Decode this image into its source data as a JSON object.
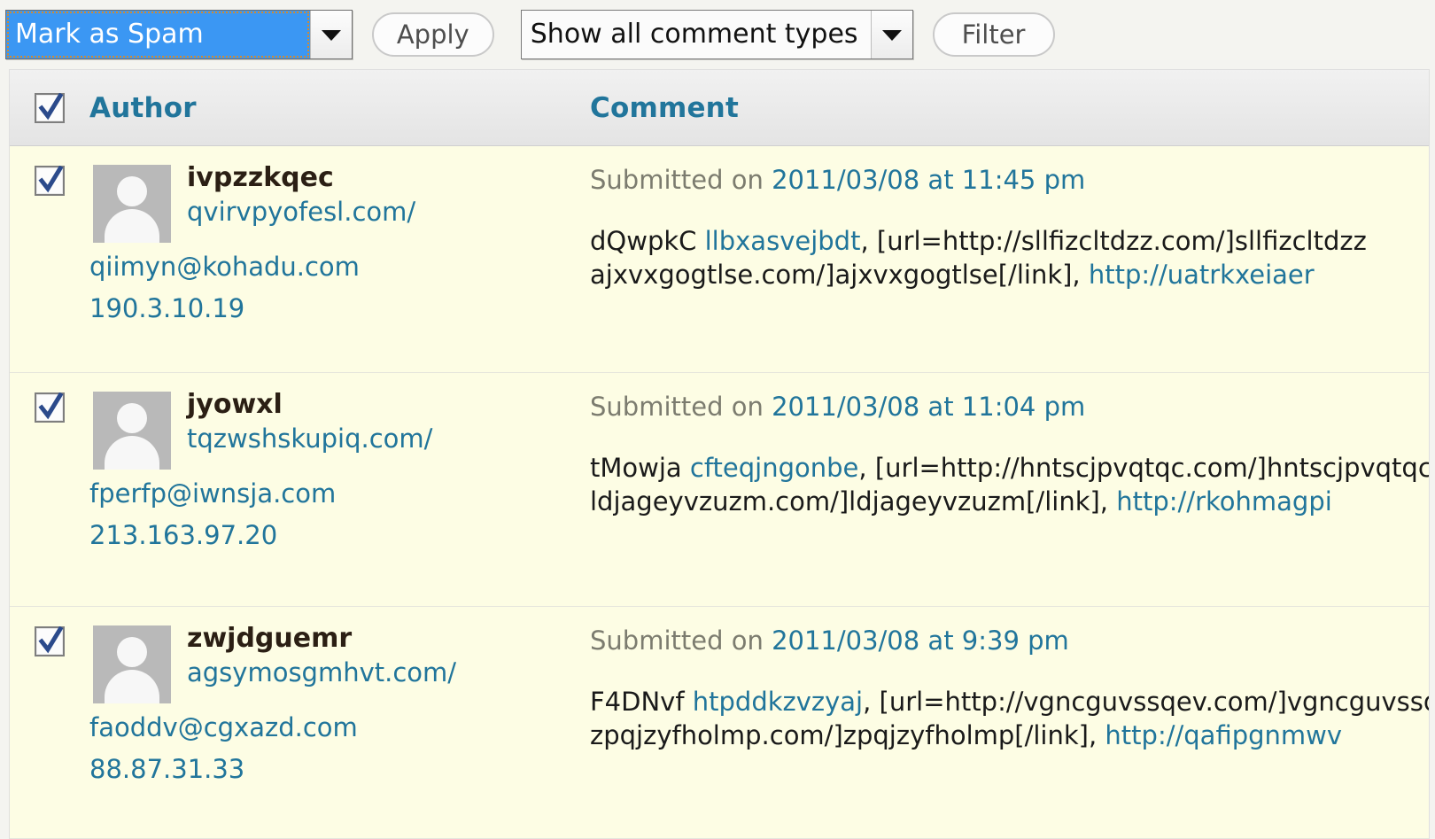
{
  "toolbar": {
    "bulk_action_value": "Mark as Spam",
    "apply_label": "Apply",
    "comment_type_value": "Show all comment types",
    "filter_label": "Filter"
  },
  "table": {
    "headers": {
      "author": "Author",
      "comment": "Comment"
    },
    "rows": [
      {
        "checked": true,
        "author": "ivpzzkqec",
        "url": "qvirvpyofesl.com/",
        "email": "qiimyn@kohadu.com",
        "ip": "190.3.10.19",
        "submitted_prefix": "Submitted on ",
        "submitted_date": "2011/03/08 at 11:45 pm",
        "comment_line1_plain_a": "dQwpkC ",
        "comment_line1_link": "llbxasvejbdt",
        "comment_line1_plain_b": ", [url=http://sllfizcltdzz.com/]sllfizcltdzz",
        "comment_line2_plain_a": "ajxvxgogtlse.com/]ajxvxgogtlse[/link], ",
        "comment_line2_link": "http://uatrkxeiaer"
      },
      {
        "checked": true,
        "author": "jyowxl",
        "url": "tqzwshskupiq.com/",
        "email": "fperfp@iwnsja.com",
        "ip": "213.163.97.20",
        "submitted_prefix": "Submitted on ",
        "submitted_date": "2011/03/08 at 11:04 pm",
        "comment_line1_plain_a": "tMowja ",
        "comment_line1_link": "cfteqjngonbe",
        "comment_line1_plain_b": ", [url=http://hntscjpvqtqc.com/]hntscjpvqtqc",
        "comment_line2_plain_a": "ldjageyvzuzm.com/]ldjageyvzuzm[/link], ",
        "comment_line2_link": "http://rkohmagpi"
      },
      {
        "checked": true,
        "author": "zwjdguemr",
        "url": "agsymosgmhvt.com/",
        "email": "faoddv@cgxazd.com",
        "ip": "88.87.31.33",
        "submitted_prefix": "Submitted on ",
        "submitted_date": "2011/03/08 at 9:39 pm",
        "comment_line1_plain_a": "F4DNvf ",
        "comment_line1_link": "htpddkzvzyaj",
        "comment_line1_plain_b": ", [url=http://vgncguvssqev.com/]vgncguvssqev",
        "comment_line2_plain_a": "zpqjzyfholmp.com/]zpqjzyfholmp[/link], ",
        "comment_line2_link": "http://qafipgnmwv"
      }
    ]
  },
  "colors": {
    "link": "#21759b",
    "row_background": "#fdfde4",
    "select_highlight": "#3b97f3",
    "focus_outline": "#d08b32"
  }
}
